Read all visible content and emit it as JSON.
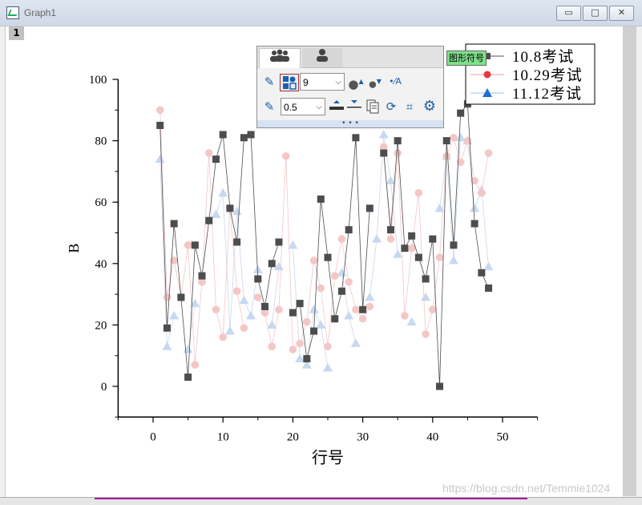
{
  "window": {
    "title": "Graph1",
    "page_tab": "1",
    "buttons": {
      "minimize": "▭",
      "maximize": "□",
      "close": "✕"
    }
  },
  "toolbar": {
    "tab_icons": [
      "group-icon",
      "person-icon"
    ],
    "symbol_size": "9",
    "line_width": "0.5",
    "dots": "• • •"
  },
  "tooltip": "图形符号",
  "watermark": "https://blog.csdn.net/Temmie1024",
  "colors": {
    "series1": "#4d4d4d",
    "series2": "#f4c7c7",
    "series3": "#c7d8f0",
    "legend_red": "#e8363b",
    "legend_blue": "#1f6fd1"
  },
  "chart_data": {
    "type": "scatter",
    "xlabel": "行号",
    "ylabel": "B",
    "xlim": [
      -5,
      55
    ],
    "ylim": [
      -10,
      100
    ],
    "xticks": [
      0,
      10,
      20,
      30,
      40,
      50
    ],
    "yticks": [
      0,
      20,
      40,
      60,
      80,
      100
    ],
    "legend_position": "top-right",
    "series": [
      {
        "name": "10.8考试",
        "marker": "square",
        "line": true,
        "x": [
          1,
          2,
          3,
          4,
          5,
          6,
          7,
          8,
          9,
          10,
          11,
          12,
          13,
          14,
          15,
          16,
          17,
          18,
          19,
          20,
          21,
          22,
          23,
          24,
          25,
          26,
          27,
          28,
          29,
          30,
          31,
          32,
          33,
          34,
          35,
          36,
          37,
          38,
          39,
          40,
          41,
          42,
          43,
          44,
          45,
          46,
          47,
          48
        ],
        "y": [
          85,
          19,
          53,
          29,
          3,
          46,
          36,
          54,
          74,
          82,
          58,
          47,
          81,
          82,
          35,
          26,
          40,
          47,
          null,
          24,
          27,
          9,
          18,
          61,
          42,
          22,
          31,
          51,
          81,
          25,
          58,
          null,
          76,
          51,
          80,
          45,
          49,
          42,
          35,
          48,
          0,
          80,
          46,
          89,
          92,
          53,
          37,
          32
        ]
      },
      {
        "name": "10.29考试",
        "marker": "circle",
        "line": true,
        "x": [
          1,
          2,
          3,
          4,
          5,
          6,
          7,
          8,
          9,
          10,
          11,
          12,
          13,
          14,
          15,
          16,
          17,
          18,
          19,
          20,
          21,
          22,
          23,
          24,
          25,
          26,
          27,
          28,
          29,
          30,
          31,
          32,
          33,
          34,
          35,
          36,
          37,
          38,
          39,
          40,
          41,
          42,
          43,
          44,
          45,
          46,
          47,
          48
        ],
        "y": [
          90,
          29,
          41,
          29,
          46,
          7,
          34,
          76,
          25,
          16,
          58,
          31,
          19,
          null,
          29,
          24,
          13,
          25,
          75,
          12,
          14,
          21,
          41,
          32,
          13,
          36,
          48,
          34,
          25,
          22,
          26,
          null,
          78,
          48,
          76,
          23,
          45,
          63,
          17,
          25,
          42,
          75,
          81,
          73,
          80,
          67,
          63,
          76
        ]
      },
      {
        "name": "11.12考试",
        "marker": "triangle",
        "line": true,
        "x": [
          1,
          2,
          3,
          4,
          5,
          6,
          7,
          8,
          9,
          10,
          11,
          12,
          13,
          14,
          15,
          16,
          17,
          18,
          19,
          20,
          21,
          22,
          23,
          24,
          25,
          26,
          27,
          28,
          29,
          30,
          31,
          32,
          33,
          34,
          35,
          36,
          37,
          38,
          39,
          40,
          41,
          42,
          43,
          44,
          45,
          46,
          47,
          48
        ],
        "y": [
          74,
          13,
          23,
          null,
          12,
          27,
          null,
          null,
          56,
          63,
          18,
          57,
          28,
          23,
          38,
          null,
          20,
          39,
          null,
          46,
          9,
          7,
          25,
          20,
          6,
          null,
          37,
          23,
          14,
          null,
          29,
          48,
          82,
          67,
          43,
          null,
          21,
          null,
          29,
          null,
          58,
          75,
          41,
          81,
          80,
          58,
          64,
          39
        ]
      }
    ]
  }
}
